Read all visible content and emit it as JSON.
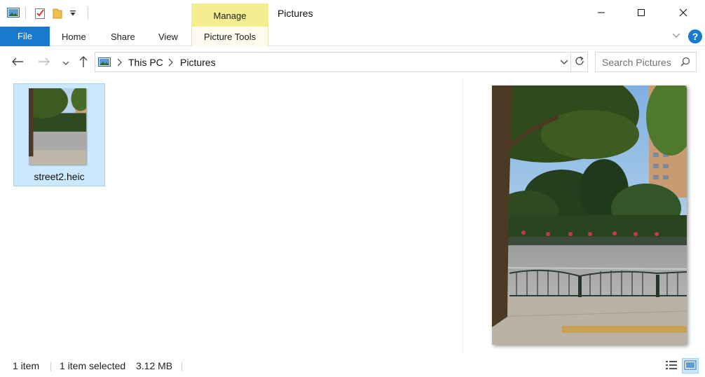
{
  "window": {
    "title": "Pictures",
    "contextual_tab": "Manage"
  },
  "ribbon": {
    "file_label": "File",
    "tabs": [
      "Home",
      "Share",
      "View"
    ],
    "contextual_label": "Picture Tools",
    "help_label": "?"
  },
  "nav": {
    "breadcrumbs": [
      "This PC",
      "Pictures"
    ],
    "search_placeholder": "Search Pictures"
  },
  "files": [
    {
      "name": "street2.heic",
      "selected": true
    }
  ],
  "status": {
    "item_count": "1 item",
    "selected": "1 item selected",
    "size": "3.12 MB"
  },
  "colors": {
    "accent": "#1979ca",
    "selection": "#cce8ff",
    "contextual": "#f4ee90"
  },
  "icons": [
    "app-icon",
    "properties-icon",
    "new-folder-icon",
    "customize-icon",
    "minimize-icon",
    "maximize-icon",
    "close-icon",
    "back-icon",
    "forward-icon",
    "recent-icon",
    "up-icon",
    "refresh-icon",
    "search-icon",
    "details-view-icon",
    "large-icons-view-icon"
  ]
}
